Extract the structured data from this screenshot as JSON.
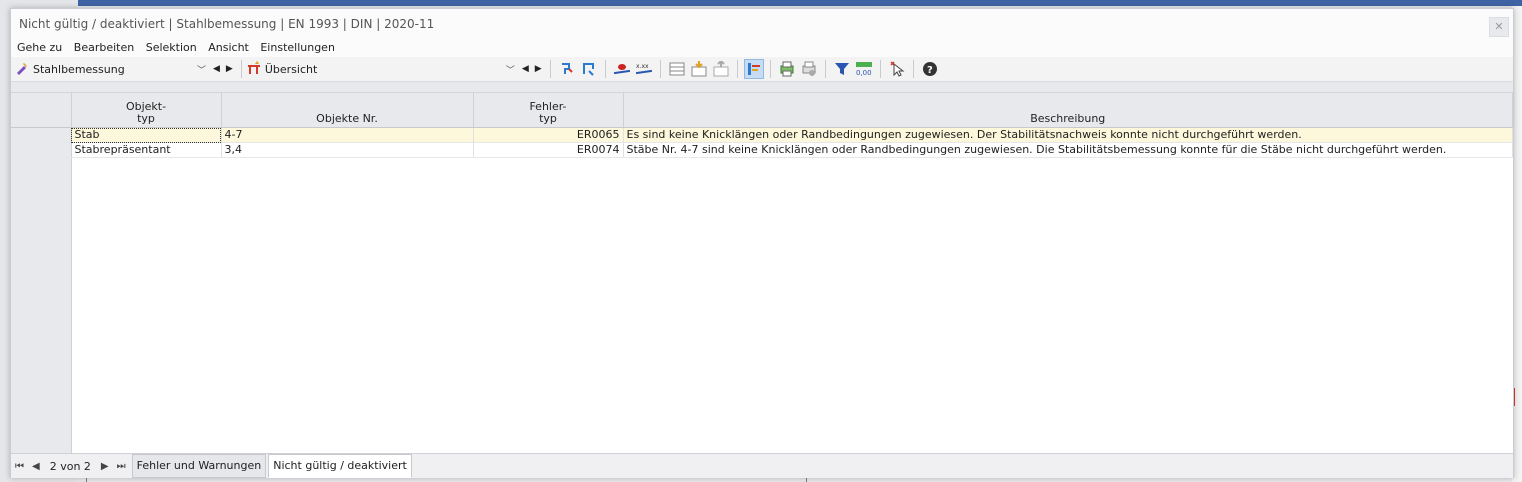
{
  "window": {
    "title": "Nicht gültig / deaktiviert | Stahlbemessung | EN 1993 | DIN | 2020-11",
    "close": "✕"
  },
  "menu": [
    "Gehe zu",
    "Bearbeiten",
    "Selektion",
    "Ansicht",
    "Einstellungen"
  ],
  "toolbar": {
    "module": "Stahlbemessung",
    "view": "Übersicht",
    "icons": [
      "select-icon",
      "deselect-icon",
      "visibility-icon",
      "values-icon",
      "table-icon",
      "import-icon",
      "export-icon",
      "highlight-icon",
      "print-icon",
      "print-settings-icon",
      "filter-icon",
      "decimal-icon",
      "pointer-icon",
      "help-icon"
    ]
  },
  "table": {
    "headers": {
      "objekttyp": [
        "Objekt-",
        "typ"
      ],
      "objekte_nr": "Objekte Nr.",
      "fehlertyp": [
        "Fehler-",
        "typ"
      ],
      "beschreibung": "Beschreibung"
    },
    "rows": [
      {
        "objekttyp": "Stab",
        "objekte_nr": "4-7",
        "fehlertyp": "ER0065",
        "beschreibung": "Es sind keine Knicklängen oder Randbedingungen zugewiesen. Der Stabilitätsnachweis konnte nicht durchgeführt werden."
      },
      {
        "objekttyp": "Stabrepräsentant",
        "objekte_nr": "3,4",
        "fehlertyp": "ER0074",
        "beschreibung": "Stäbe Nr. 4-7 sind keine Knicklängen oder Randbedingungen zugewiesen. Die Stabilitätsbemessung konnte für die Stäbe nicht durchgeführt werden."
      }
    ]
  },
  "bottom": {
    "pager": "2 von 2",
    "tabs": [
      "Fehler und Warnungen",
      "Nicht gültig / deaktiviert"
    ]
  },
  "colors": {
    "selected_row": "#fdf8dc",
    "active_tool": "#c7dcf3",
    "app_header": "#3f64a6"
  }
}
